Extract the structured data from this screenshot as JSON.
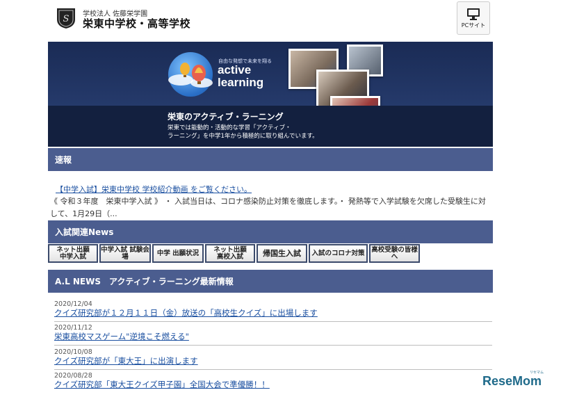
{
  "header": {
    "school_sub": "学校法人 佐藤栄学園",
    "school_name": "栄東中学校・高等学校",
    "pc_site_label": "PCサイト"
  },
  "banner": {
    "tagline": "自由な発想で未来を翔る",
    "active": "active",
    "learning": "learning",
    "title": "栄東のアクティブ・ラーニング",
    "desc_line1": "栄東では能動的・活動的な学習「アクティブ・",
    "desc_line2": "ラーニング」を中学1年から積極的に取り組んでいます。"
  },
  "sections": {
    "sokuho": "速報",
    "exam_news": "入試関連News",
    "al_news": "A.L NEWS　アクティブ・ラーニング最新情報"
  },
  "sokuho_item": {
    "link": "【中学入試】栄東中学校 学校紹介動画 をご覧ください。",
    "body": "《 令和３年度　栄東中学入試 》 ・ 入試当日は、コロナ感染防止対策を徹底します。・ 発熱等で入学試験を欠席した受験生に対して、1月29日（..."
  },
  "exam_buttons": [
    {
      "line1": "ネット出願",
      "line2": "中学入試"
    },
    {
      "line1": "中学入試 試験会場",
      "line2": ""
    },
    {
      "line1": "中学 出願状況",
      "line2": ""
    },
    {
      "line1": "ネット出願",
      "line2": "高校入試"
    },
    {
      "line1": "帰国生入試",
      "line2": ""
    },
    {
      "line1": "入試のコロナ対策",
      "line2": ""
    },
    {
      "line1": "高校受験の皆様へ",
      "line2": ""
    }
  ],
  "al_news_items": [
    {
      "date": "2020/12/04",
      "title": "クイズ研究部が１２月１１日（金）放送の「高校生クイズ」に出場します"
    },
    {
      "date": "2020/11/12",
      "title": "栄東高校マスゲーム\"逆境こそ燃える\""
    },
    {
      "date": "2020/10/08",
      "title": "クイズ研究部が「東大王」に出演します"
    },
    {
      "date": "2020/08/28",
      "title": "クイズ研究部「東大王クイズ甲子園」全国大会で準優勝！！"
    }
  ],
  "watermark": {
    "text": "ReseMom",
    "small": "リセマム"
  },
  "colors": {
    "section_bar": "#4b5d8f",
    "banner_bg": "#1c2c55",
    "link": "#1a4fa0"
  }
}
